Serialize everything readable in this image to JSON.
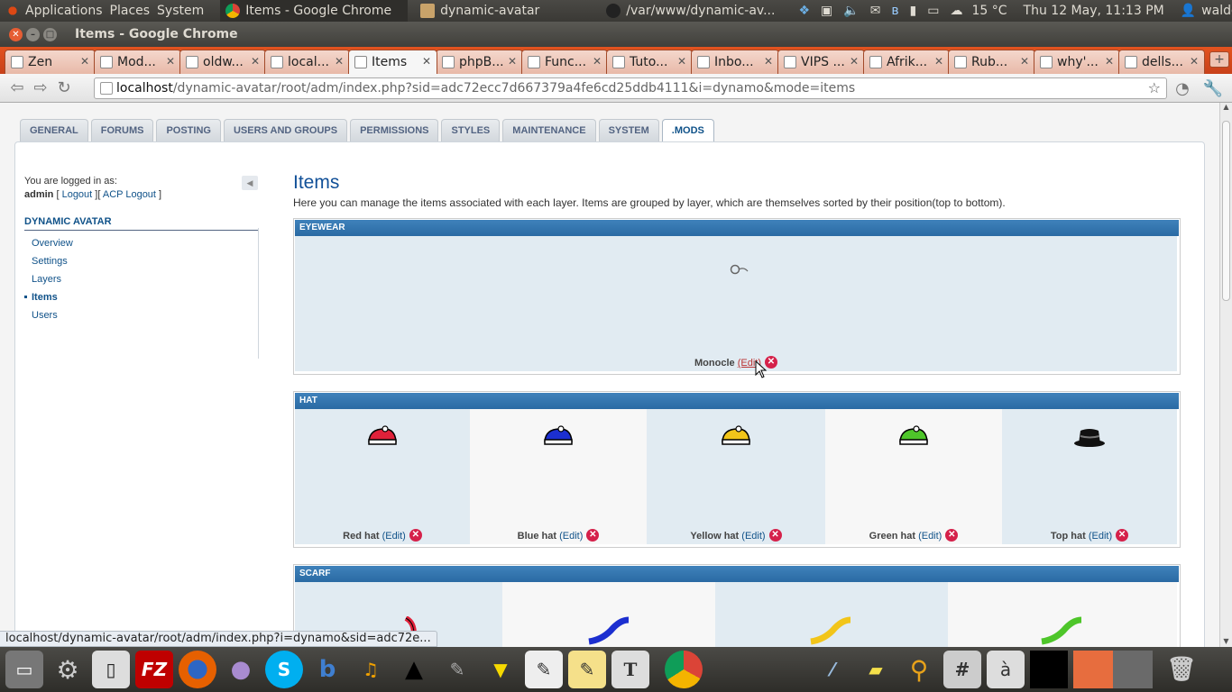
{
  "topbar": {
    "menus": [
      "Applications",
      "Places",
      "System"
    ],
    "windows": [
      "Items - Google Chrome",
      "dynamic-avatar",
      "/var/www/dynamic-av..."
    ],
    "weather": "15 °C",
    "clock": "Thu 12 May, 11:13 PM",
    "user": "waldo"
  },
  "window": {
    "title": "Items - Google Chrome"
  },
  "browser_tabs": [
    {
      "label": "Zen"
    },
    {
      "label": "Mod..."
    },
    {
      "label": "oldw..."
    },
    {
      "label": "local..."
    },
    {
      "label": "Items",
      "active": true
    },
    {
      "label": "phpB..."
    },
    {
      "label": "Func..."
    },
    {
      "label": "Tuto..."
    },
    {
      "label": "Inbo..."
    },
    {
      "label": "VIPS ..."
    },
    {
      "label": "Afrik..."
    },
    {
      "label": "Rub..."
    },
    {
      "label": "why'..."
    },
    {
      "label": "dells..."
    }
  ],
  "url": {
    "host": "localhost",
    "path": "/dynamic-avatar/root/adm/index.php?sid=adc72ecc7d667379a4fe6cd25ddb4111&i=dynamo&mode=items"
  },
  "admin_tabs": [
    "GENERAL",
    "FORUMS",
    "POSTING",
    "USERS AND GROUPS",
    "PERMISSIONS",
    "STYLES",
    "MAINTENANCE",
    "SYSTEM",
    ".MODS"
  ],
  "sidebar": {
    "logged_in_label": "You are logged in as:",
    "username": "admin",
    "logout": "Logout",
    "acp_logout": "ACP Logout",
    "section_title": "DYNAMIC AVATAR",
    "items": [
      "Overview",
      "Settings",
      "Layers",
      "Items",
      "Users"
    ],
    "active_item": "Items"
  },
  "main": {
    "title": "Items",
    "description": "Here you can manage the items associated with each layer. Items are grouped by layer, which are themselves sorted by their position(top to bottom).",
    "edit_label": "(Edit)",
    "layers": [
      {
        "name": "EYEWEAR",
        "items": [
          {
            "name": "Monocle"
          }
        ]
      },
      {
        "name": "HAT",
        "items": [
          {
            "name": "Red hat",
            "color": "#e0213a"
          },
          {
            "name": "Blue hat",
            "color": "#1c2fd0"
          },
          {
            "name": "Yellow hat",
            "color": "#f2c51a"
          },
          {
            "name": "Green hat",
            "color": "#4ec62a"
          },
          {
            "name": "Top hat",
            "color": "#111111"
          }
        ]
      },
      {
        "name": "SCARF",
        "items": []
      }
    ]
  },
  "status_url": "localhost/dynamic-avatar/root/adm/index.php?i=dynamo&sid=adc72e..."
}
